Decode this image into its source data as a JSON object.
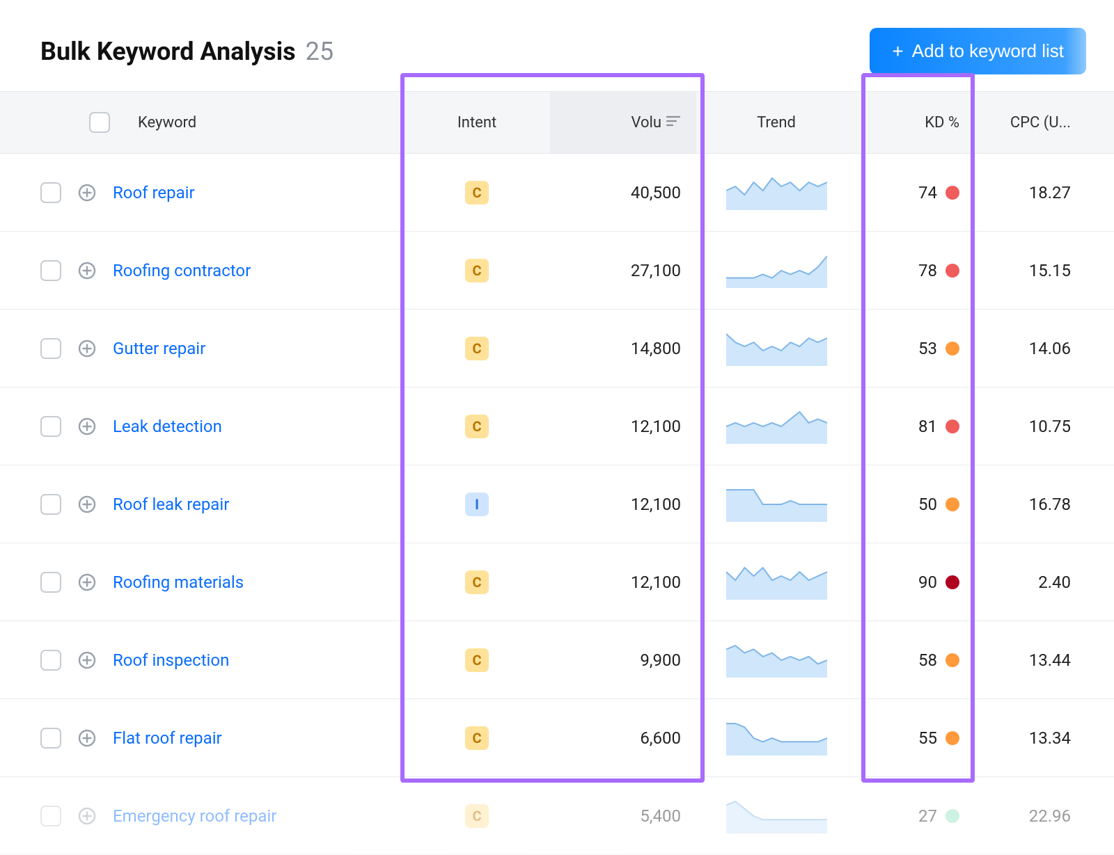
{
  "header": {
    "title": "Bulk Keyword Analysis",
    "count": "25",
    "add_button": "Add to keyword list"
  },
  "columns": {
    "keyword": "Keyword",
    "intent": "Intent",
    "volume": "Volu",
    "trend": "Trend",
    "kd": "KD %",
    "cpc": "CPC (U..."
  },
  "intent_labels": {
    "C": "C",
    "I": "I"
  },
  "kd_colors": {
    "red": "#f05c5c",
    "orange": "#ff9a3c",
    "darkred": "#b00020",
    "green": "#8fe3c4"
  },
  "rows": [
    {
      "keyword": "Roof repair",
      "intent": "C",
      "volume": "40,500",
      "kd": "74",
      "kd_color": "red",
      "cpc": "18.27",
      "trend": [
        4,
        5,
        3,
        6,
        4,
        7,
        5,
        6,
        4,
        6,
        5,
        6
      ]
    },
    {
      "keyword": "Roofing contractor",
      "intent": "C",
      "volume": "27,100",
      "kd": "78",
      "kd_color": "red",
      "cpc": "15.15",
      "trend": [
        2,
        2,
        2,
        2,
        3,
        2,
        4,
        3,
        4,
        3,
        5,
        8
      ]
    },
    {
      "keyword": "Gutter repair",
      "intent": "C",
      "volume": "14,800",
      "kd": "53",
      "kd_color": "orange",
      "cpc": "14.06",
      "trend": [
        7,
        5,
        4,
        5,
        3,
        4,
        3,
        5,
        4,
        6,
        5,
        6
      ]
    },
    {
      "keyword": "Leak detection",
      "intent": "C",
      "volume": "12,100",
      "kd": "81",
      "kd_color": "red",
      "cpc": "10.75",
      "trend": [
        4,
        5,
        4,
        5,
        4,
        5,
        4,
        6,
        8,
        5,
        6,
        5
      ]
    },
    {
      "keyword": "Roof leak repair",
      "intent": "I",
      "volume": "12,100",
      "kd": "50",
      "kd_color": "orange",
      "cpc": "16.78",
      "trend": [
        8,
        8,
        8,
        8,
        4,
        4,
        4,
        5,
        4,
        4,
        4,
        4
      ]
    },
    {
      "keyword": "Roofing materials",
      "intent": "C",
      "volume": "12,100",
      "kd": "90",
      "kd_color": "darkred",
      "cpc": "2.40",
      "trend": [
        6,
        4,
        7,
        5,
        7,
        4,
        5,
        4,
        6,
        4,
        5,
        6
      ]
    },
    {
      "keyword": "Roof inspection",
      "intent": "C",
      "volume": "9,900",
      "kd": "58",
      "kd_color": "orange",
      "cpc": "13.44",
      "trend": [
        7,
        8,
        6,
        7,
        5,
        6,
        4,
        5,
        4,
        5,
        3,
        4
      ]
    },
    {
      "keyword": "Flat roof repair",
      "intent": "C",
      "volume": "6,600",
      "kd": "55",
      "kd_color": "orange",
      "cpc": "13.34",
      "trend": [
        8,
        8,
        7,
        4,
        3,
        4,
        3,
        3,
        3,
        3,
        3,
        4
      ]
    },
    {
      "keyword": "Emergency roof repair",
      "intent": "C",
      "volume": "5,400",
      "kd": "27",
      "kd_color": "green",
      "cpc": "22.96",
      "trend": [
        7,
        8,
        6,
        4,
        3,
        3,
        3,
        3,
        3,
        3,
        3,
        3
      ],
      "faded": true
    }
  ]
}
